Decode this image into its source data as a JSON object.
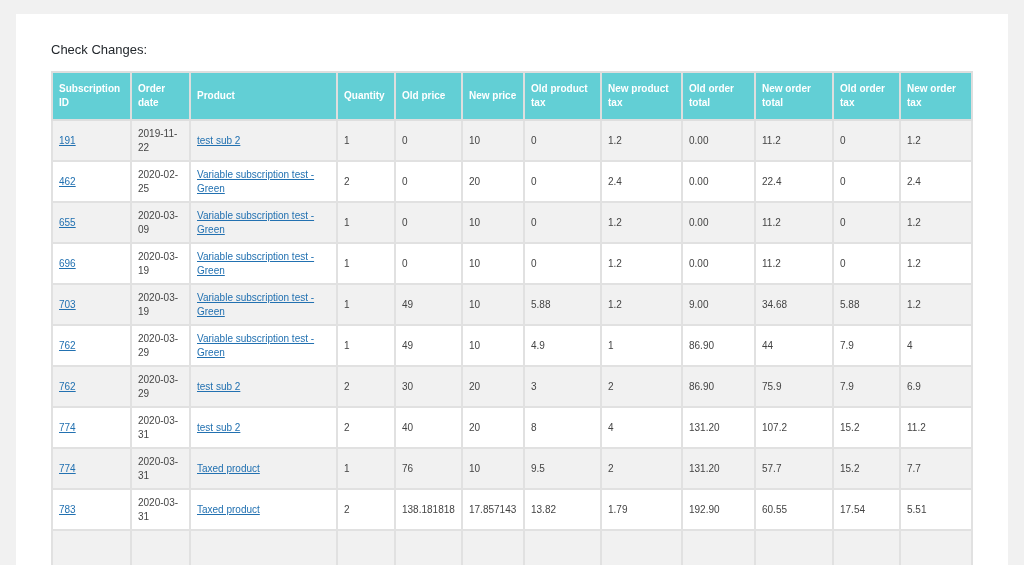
{
  "title": "Check Changes:",
  "table": {
    "columns": [
      {
        "label": "Subscription ID",
        "kind": "link"
      },
      {
        "label": "Order date",
        "kind": "text"
      },
      {
        "label": "Product",
        "kind": "link"
      },
      {
        "label": "Quantity",
        "kind": "text"
      },
      {
        "label": "Old price",
        "kind": "text"
      },
      {
        "label": "New price",
        "kind": "text"
      },
      {
        "label": "Old product tax",
        "kind": "text"
      },
      {
        "label": "New product tax",
        "kind": "text"
      },
      {
        "label": "Old order total",
        "kind": "text"
      },
      {
        "label": "New order total",
        "kind": "text"
      },
      {
        "label": "Old order tax",
        "kind": "text"
      },
      {
        "label": "New order tax",
        "kind": "text"
      }
    ],
    "rows": [
      [
        "191",
        "2019-11-22",
        "test sub 2",
        "1",
        "0",
        "10",
        "0",
        "1.2",
        "0.00",
        "11.2",
        "0",
        "1.2"
      ],
      [
        "462",
        "2020-02-25",
        "Variable subscription test - Green",
        "2",
        "0",
        "20",
        "0",
        "2.4",
        "0.00",
        "22.4",
        "0",
        "2.4"
      ],
      [
        "655",
        "2020-03-09",
        "Variable subscription test - Green",
        "1",
        "0",
        "10",
        "0",
        "1.2",
        "0.00",
        "11.2",
        "0",
        "1.2"
      ],
      [
        "696",
        "2020-03-19",
        "Variable subscription test - Green",
        "1",
        "0",
        "10",
        "0",
        "1.2",
        "0.00",
        "11.2",
        "0",
        "1.2"
      ],
      [
        "703",
        "2020-03-19",
        "Variable subscription test - Green",
        "1",
        "49",
        "10",
        "5.88",
        "1.2",
        "9.00",
        " 34.68",
        "5.88",
        "1.2"
      ],
      [
        "762",
        "2020-03-29",
        "Variable subscription test - Green",
        "1",
        "49",
        "10",
        "4.9",
        "1",
        "86.90",
        "44",
        "7.9",
        "4"
      ],
      [
        "762",
        "2020-03-29",
        "test sub 2",
        "2",
        "30",
        "20",
        "3",
        "2",
        "86.90",
        "75.9",
        "7.9",
        "6.9"
      ],
      [
        "774",
        "2020-03-31",
        "test sub 2",
        "2",
        "40",
        "20",
        "8",
        "4",
        "131.20",
        "107.2",
        "15.2",
        "11.2"
      ],
      [
        "774",
        "2020-03-31",
        "Taxed product",
        "1",
        "76",
        "10",
        "9.5",
        "2",
        "131.20",
        "57.7",
        "15.2",
        "7.7"
      ],
      [
        "783",
        "2020-03-31",
        "Taxed product",
        "2",
        "138.181818",
        "17.857143",
        "13.82",
        "1.79",
        "192.90",
        "60.55",
        "17.54",
        "5.51"
      ]
    ]
  }
}
